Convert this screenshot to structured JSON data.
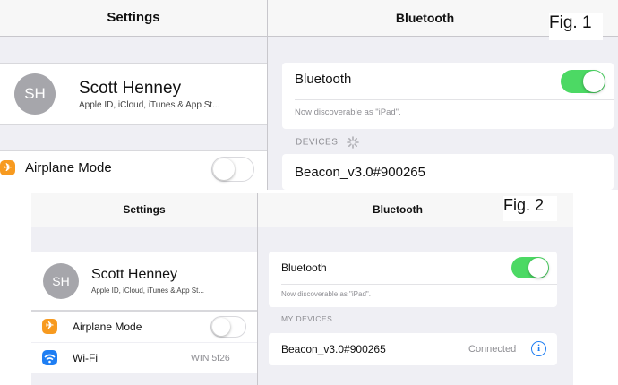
{
  "fig1": {
    "label": "Fig. 1",
    "sidebar": {
      "title": "Settings",
      "profile": {
        "initials": "SH",
        "name": "Scott Henney",
        "subtitle": "Apple ID, iCloud, iTunes & App St..."
      },
      "airplane_mode": {
        "label": "Airplane Mode",
        "icon": "airplane-icon",
        "enabled": false
      }
    },
    "main": {
      "title": "Bluetooth",
      "bluetooth": {
        "label": "Bluetooth",
        "enabled": true
      },
      "discoverable_note": "Now discoverable as \"iPad\".",
      "devices_header": "DEVICES",
      "devices": [
        {
          "name": "Beacon_v3.0#900265"
        }
      ]
    }
  },
  "fig2": {
    "label": "Fig. 2",
    "sidebar": {
      "title": "Settings",
      "profile": {
        "initials": "SH",
        "name": "Scott Henney",
        "subtitle": "Apple ID, iCloud, iTunes & App St..."
      },
      "airplane_mode": {
        "label": "Airplane Mode",
        "icon": "airplane-icon",
        "enabled": false
      },
      "wifi": {
        "label": "Wi-Fi",
        "value": "WIN 5f26",
        "icon": "wifi-icon"
      }
    },
    "main": {
      "title": "Bluetooth",
      "bluetooth": {
        "label": "Bluetooth",
        "enabled": true
      },
      "discoverable_note": "Now discoverable as \"iPad\".",
      "devices_header": "MY DEVICES",
      "devices": [
        {
          "name": "Beacon_v3.0#900265",
          "status": "Connected"
        }
      ]
    }
  },
  "colors": {
    "toggle_on": "#4cd964",
    "airplane_icon": "#f79a1f",
    "wifi_icon": "#1e7ef3",
    "info_icon": "#1e7ef3"
  }
}
